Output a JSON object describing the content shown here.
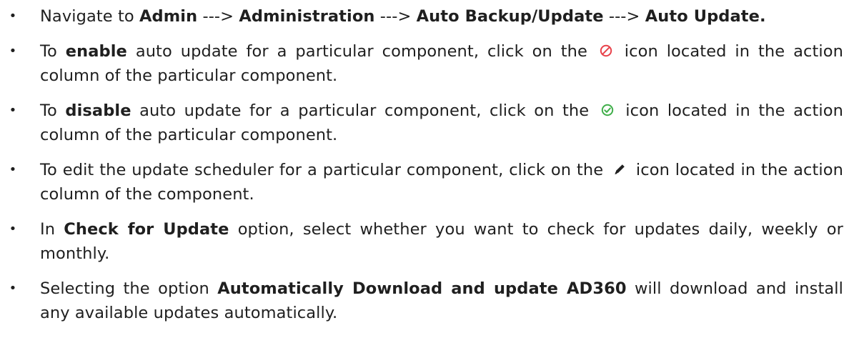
{
  "steps": [
    {
      "parts": [
        {
          "text": "Navigate to ",
          "bold": false
        },
        {
          "text": "Admin",
          "bold": true
        },
        {
          "text": " ---> ",
          "bold": false
        },
        {
          "text": "Administration",
          "bold": true
        },
        {
          "text": " ---> ",
          "bold": false
        },
        {
          "text": "Auto Backup/Update",
          "bold": true
        },
        {
          "text": " ---> ",
          "bold": false
        },
        {
          "text": "Auto Update.",
          "bold": true
        }
      ]
    },
    {
      "parts": [
        {
          "text": "To ",
          "bold": false
        },
        {
          "text": "enable",
          "bold": true
        },
        {
          "text": " auto update for a particular component, click on the ",
          "bold": false
        },
        {
          "icon": "disabled-status-icon"
        },
        {
          "text": " icon located in the action column of the particular component.",
          "bold": false
        }
      ]
    },
    {
      "parts": [
        {
          "text": "To ",
          "bold": false
        },
        {
          "text": "disable",
          "bold": true
        },
        {
          "text": " auto update for a particular component, click on the ",
          "bold": false
        },
        {
          "icon": "enabled-status-icon"
        },
        {
          "text": " icon located in the action column of the particular component.",
          "bold": false
        }
      ]
    },
    {
      "parts": [
        {
          "text": "To edit the update scheduler for a particular component, click on the ",
          "bold": false
        },
        {
          "icon": "pencil-icon"
        },
        {
          "text": " icon located in the action column of the component.",
          "bold": false
        }
      ]
    },
    {
      "parts": [
        {
          "text": "In ",
          "bold": false
        },
        {
          "text": "Check for Update",
          "bold": true
        },
        {
          "text": " option, select whether you want to check for updates daily, weekly or monthly.",
          "bold": false
        }
      ]
    },
    {
      "parts": [
        {
          "text": "Selecting the option ",
          "bold": false
        },
        {
          "text": "Automatically Download and update AD360",
          "bold": true
        },
        {
          "text": " will download and install any available updates automatically.",
          "bold": false
        }
      ]
    }
  ],
  "bullet_char": "•",
  "colors": {
    "text": "#1f1f1f",
    "disabled_icon": "#e8424a",
    "enabled_icon": "#3fae49",
    "pencil_icon": "#222222"
  }
}
